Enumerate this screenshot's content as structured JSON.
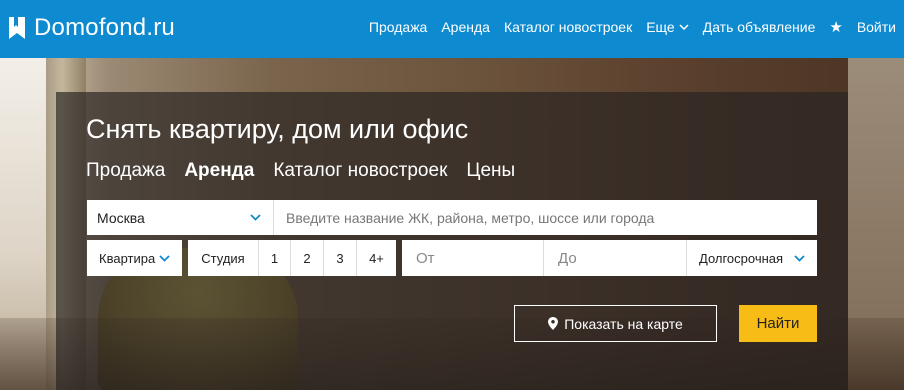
{
  "header": {
    "logo_text": "Domofond.ru",
    "nav": [
      {
        "label": "Продажа"
      },
      {
        "label": "Аренда"
      },
      {
        "label": "Каталог новостроек"
      },
      {
        "label": "Еще"
      },
      {
        "label": "Дать объявление"
      },
      {
        "label": "Войти"
      }
    ],
    "star_icon": "★",
    "bg_color": "#0d8ad0"
  },
  "search": {
    "title": "Снять квартиру, дом или офис",
    "tabs": [
      {
        "label": "Продажа"
      },
      {
        "label": "Аренда"
      },
      {
        "label": "Каталог новостроек"
      },
      {
        "label": "Цены"
      }
    ],
    "active_tab": "Аренда",
    "city_value": "Москва",
    "place_placeholder": "Введите название ЖК, района, метро, шоссе или города",
    "type_value": "Квартира",
    "rooms": [
      "Студия",
      "1",
      "2",
      "3",
      "4+"
    ],
    "price_from_placeholder": "От",
    "price_to_placeholder": "До",
    "term_value": "Долгосрочная",
    "map_button": "Показать на карте",
    "find_button": "Найти",
    "accent_color": "#f8bc16",
    "chevron_color": "#0d8ad0"
  }
}
